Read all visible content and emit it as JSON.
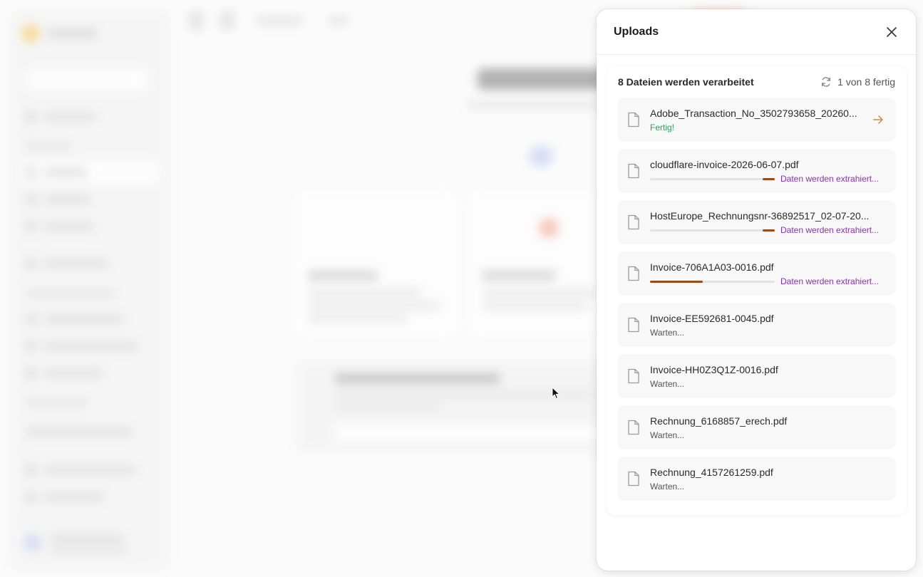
{
  "uploads_panel": {
    "title": "Uploads",
    "summary": "8 Dateien werden verarbeitet",
    "progress_text": "1 von 8 fertig",
    "files": [
      {
        "name": "Adobe_Transaction_No_3502793658_20260...",
        "status": "Fertig!",
        "state": "done"
      },
      {
        "name": "cloudflare-invoice-2026-06-07.pdf",
        "status": "Daten werden extrahiert...",
        "state": "extracting",
        "progress": 0.1
      },
      {
        "name": "HostEurope_Rechnungsnr-36892517_02-07-20...",
        "status": "Daten werden extrahiert...",
        "state": "extracting",
        "progress": 0.1
      },
      {
        "name": "Invoice-706A1A03-0016.pdf",
        "status": "Daten werden extrahiert...",
        "state": "extracting",
        "progress": 0.42
      },
      {
        "name": "Invoice-EE592681-0045.pdf",
        "status": "Warten...",
        "state": "waiting"
      },
      {
        "name": "Invoice-HH0Z3Q1Z-0016.pdf",
        "status": "Warten...",
        "state": "waiting"
      },
      {
        "name": "Rechnung_6168857_erech.pdf",
        "status": "Warten...",
        "state": "waiting"
      },
      {
        "name": "Rechnung_4157261259.pdf",
        "status": "Warten...",
        "state": "waiting"
      }
    ]
  },
  "colors": {
    "done": "#22a05b",
    "extracting": "#8b2fb8",
    "progress_fill": "#9c4a1a",
    "arrow": "#c98a4a"
  },
  "icons": {
    "close": "close-icon",
    "sync": "sync-icon",
    "file": "file-icon",
    "open": "arrow-right-icon"
  }
}
